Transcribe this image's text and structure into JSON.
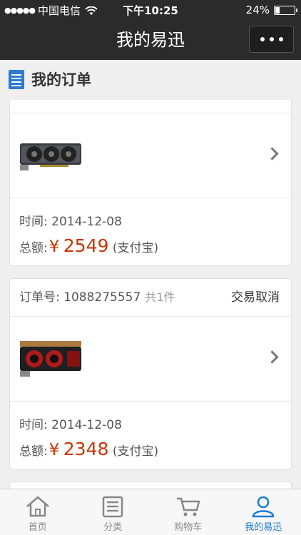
{
  "status": {
    "carrier": "中国电信",
    "time": "下午10:25",
    "battery": "24%",
    "battery_level": 0.24
  },
  "nav": {
    "title": "我的易迅"
  },
  "section": {
    "title": "我的订单"
  },
  "orders": [
    {
      "time_label": "时间:",
      "time": "2014-12-08",
      "total_label": "总额:",
      "currency": "¥",
      "amount": "2549",
      "payment": "(支付宝)"
    },
    {
      "order_label": "订单号:",
      "order_no": "1088275557",
      "count": "共1件",
      "status": "交易取消",
      "time_label": "时间:",
      "time": "2014-12-08",
      "total_label": "总额:",
      "currency": "¥",
      "amount": "2348",
      "payment": "(支付宝)"
    }
  ],
  "tabbar": {
    "items": [
      {
        "label": "首页",
        "icon": "home-icon"
      },
      {
        "label": "分类",
        "icon": "list-icon"
      },
      {
        "label": "购物车",
        "icon": "cart-icon"
      },
      {
        "label": "我的易迅",
        "icon": "user-icon",
        "active": true
      }
    ]
  },
  "colors": {
    "accent": "#1a7ad8",
    "price": "#cc3300",
    "header": "#2b2b2b"
  }
}
